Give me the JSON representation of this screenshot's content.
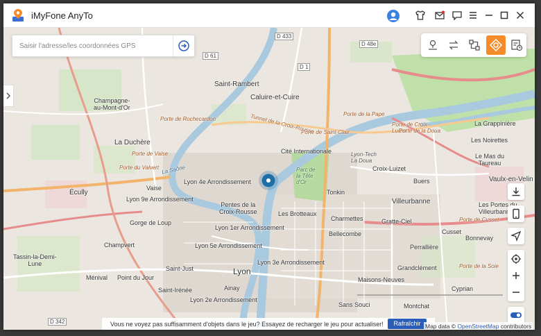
{
  "window": {
    "title": "iMyFone AnyTo",
    "controls": [
      "user-icon",
      "tshirt-icon",
      "mail-icon",
      "feedback-icon",
      "menu-icon",
      "minimize-icon",
      "maximize-icon",
      "close-icon"
    ]
  },
  "search": {
    "placeholder": "Saisir l'adresse/les coordonnées GPS",
    "value": ""
  },
  "modes": [
    "teleport-mode-icon",
    "two-spot-mode-icon",
    "multi-spot-mode-icon",
    "joystick-mode-icon",
    "history-icon"
  ],
  "active_mode": "joystick-mode-icon",
  "colors": {
    "accent": "#f58b2a",
    "button": "#2a5db8",
    "pin": "#1e6fa8"
  },
  "map": {
    "labels": {
      "saint_rambert": "Saint-Rambert",
      "caluire": "Caluire-et-Cuire",
      "champagne": "Champagne-\nau-Mont-d'Or",
      "la_duchere": "La Duchère",
      "ecully": "Écully",
      "vaise": "Vaise",
      "lyon4": "Lyon 4e Arrondissement",
      "lyon9": "Lyon 9e Arrondissement",
      "pentes": "Pentes de la\nCroix-Rousse",
      "cite_int": "Cité Internationale",
      "croix_luizet": "Croix-Luizet",
      "la_grappiniere": "La Grappinière",
      "les_noirettes": "Les Noirettes",
      "le_mas": "Le Mas du\nTaureau",
      "vaulx": "Vaulx-en-Velin",
      "buers": "Buers",
      "tonkin": "Tonkin",
      "villeurbanne": "Villeurbanne",
      "les_brotteaux": "Les Brotteaux",
      "charmettes": "Charmettes",
      "gratte_ciel": "Gratte-Ciel",
      "gorge_de_loup": "Gorge de Loup",
      "lyon1": "Lyon 1er Arrondissement",
      "bellecombe": "Bellecombe",
      "cusset": "Cusset",
      "bonnevay": "Bonnevay",
      "champvert": "Champvert",
      "lyon5": "Lyon 5e Arrondissement",
      "perralliere": "Perrallière",
      "tassin": "Tassin-la-Demi-\nLune",
      "lyon3": "Lyon 3e Arrondissement",
      "lyon": "Lyon",
      "saint_just": "Saint-Just",
      "grandclement": "Grandclément",
      "menival": "Ménival",
      "point_du_jour": "Point du Jour",
      "maisons_neuves": "Maisons-Neuves",
      "saint_irenee": "Saint-Irénée",
      "ainay": "Ainay",
      "cyprian": "Cyprian",
      "lyon2": "Lyon 2e Arrondissement",
      "sans_souci": "Sans Souci",
      "montchat": "Montchat",
      "les_portes": "Les Portes du\nVilleurbanne",
      "pdc_rochecardon": "Porte de Rochecardon",
      "pdc_vaise": "Porte de Vaise",
      "pdc_valvert": "Porte du Valvert",
      "pdc_la_pape": "Porte de la Pape",
      "pdc_croix": "Porte de Croix-\nLuizet",
      "pdc_doua": "Porte de la Doua",
      "pdc_st_clair": "Porte de Saint-Clair",
      "pdc_cusset": "Porte de Cusset",
      "pdc_soie": "Porte de la Soie",
      "tunnel": "Tunnel de la Croix-Rousse",
      "la_saone": "La Saône",
      "parc_tete": "Parc de\nla Tête\nd'Or",
      "lyon_tech": "Lyon-Tech\nLa Doua",
      "d433": "D 433",
      "d48e": "D 48e",
      "d1": "D 1",
      "d342": "D 342",
      "d61": "D 61"
    }
  },
  "notice": {
    "text": "Vous ne voyez pas suffisamment d'objets dans le jeu? Essayez de recharger le jeu pour actualiser!",
    "button": "Rafraîchir"
  },
  "attribution": {
    "prefix": "Map data © ",
    "link": "OpenStreetMap",
    "suffix": " contributors"
  }
}
